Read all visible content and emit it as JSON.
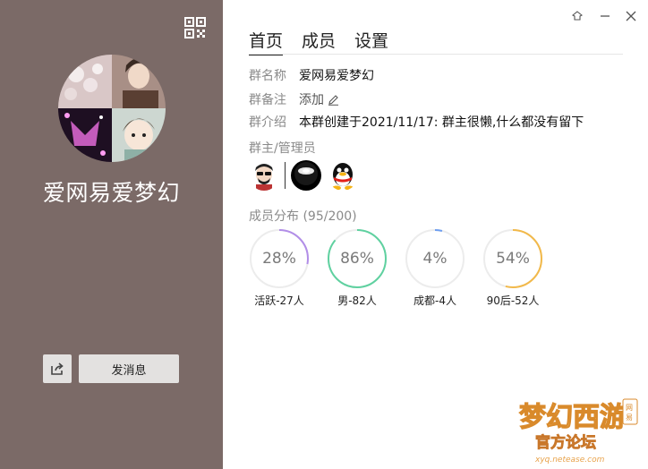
{
  "group": {
    "name": "爱网易爱梦幻"
  },
  "left_panel": {
    "send_label": "发消息"
  },
  "tabs": [
    {
      "label": "首页"
    },
    {
      "label": "成员"
    },
    {
      "label": "设置"
    }
  ],
  "info": {
    "name_key": "群名称",
    "name_value": "爱网易爱梦幻",
    "remark_key": "群备注",
    "remark_value": "添加",
    "intro_key": "群介绍",
    "intro_value": "本群创建于2021/11/17:  群主很懒,什么都没有留下"
  },
  "admins": {
    "label": "群主/管理员"
  },
  "distribution": {
    "label": "成员分布 (95/200)",
    "items": [
      {
        "percent_text": "28%",
        "value": 0.28,
        "color": "#b28ee8",
        "caption": "活跃-27人"
      },
      {
        "percent_text": "86%",
        "value": 0.86,
        "color": "#5fd1a0",
        "caption": "男-82人"
      },
      {
        "percent_text": "4%",
        "value": 0.04,
        "color": "#6e9ef0",
        "caption": "成都-4人"
      },
      {
        "percent_text": "54%",
        "value": 0.54,
        "color": "#f2b94a",
        "caption": "90后-52人"
      }
    ]
  },
  "watermark": {
    "title": "梦幻西游",
    "badge": "网易",
    "subtitle": "官方论坛",
    "url": "xyq.netease.com"
  }
}
